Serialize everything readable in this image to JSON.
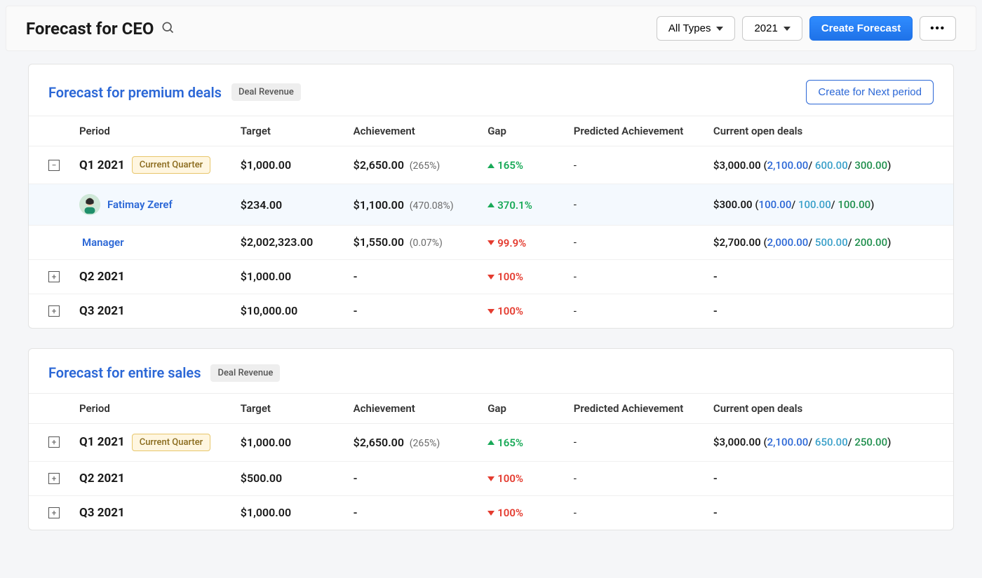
{
  "header": {
    "title": "Forecast for CEO",
    "type_filter": "All Types",
    "year_filter": "2021",
    "create_button": "Create Forecast"
  },
  "columns": {
    "period": "Period",
    "target": "Target",
    "achievement": "Achievement",
    "gap": "Gap",
    "predicted": "Predicted Achievement",
    "open_deals": "Current open deals"
  },
  "panels": [
    {
      "title": "Forecast for premium deals",
      "tag": "Deal Revenue",
      "action_button": "Create for Next period",
      "rows": [
        {
          "expand": "minus",
          "period": "Q1 2021",
          "current": "Current Quarter",
          "target": "$1,000.00",
          "achievement": "$2,650.00",
          "achievement_pct": "(265%)",
          "gap_dir": "up",
          "gap": "165%",
          "predicted": "-",
          "deals_total": "$3,000.00",
          "deals_b1": "2,100.00",
          "deals_b2": "600.00",
          "deals_b3": "300.00"
        },
        {
          "sub": true,
          "avatar": true,
          "name": "Fatimay Zeref",
          "target": "$234.00",
          "achievement": "$1,100.00",
          "achievement_pct": "(470.08%)",
          "gap_dir": "up",
          "gap": "370.1%",
          "predicted": "-",
          "deals_total": "$300.00",
          "deals_b1": "100.00",
          "deals_b2": "100.00",
          "deals_b3": "100.00"
        },
        {
          "sub": false,
          "name_only": true,
          "name": "Manager",
          "target": "$2,002,323.00",
          "achievement": "$1,550.00",
          "achievement_pct": "(0.07%)",
          "gap_dir": "down",
          "gap": "99.9%",
          "predicted": "-",
          "deals_total": "$2,700.00",
          "deals_b1": "2,000.00",
          "deals_b2": "500.00",
          "deals_b3": "200.00"
        },
        {
          "expand": "plus",
          "period": "Q2 2021",
          "target": "$1,000.00",
          "achievement": "-",
          "gap_dir": "down",
          "gap": "100%",
          "predicted": "-",
          "open_dash": "-"
        },
        {
          "expand": "plus",
          "period": "Q3 2021",
          "target": "$10,000.00",
          "achievement": "-",
          "gap_dir": "down",
          "gap": "100%",
          "predicted": "-",
          "open_dash": "-"
        }
      ]
    },
    {
      "title": "Forecast for entire sales",
      "tag": "Deal Revenue",
      "rows": [
        {
          "expand": "plus",
          "period": "Q1 2021",
          "current": "Current Quarter",
          "target": "$1,000.00",
          "achievement": "$2,650.00",
          "achievement_pct": "(265%)",
          "gap_dir": "up",
          "gap": "165%",
          "predicted": "-",
          "deals_total": "$3,000.00",
          "deals_b1": "2,100.00",
          "deals_b2": "650.00",
          "deals_b3": "250.00"
        },
        {
          "expand": "plus",
          "period": "Q2 2021",
          "target": "$500.00",
          "achievement": "-",
          "gap_dir": "down",
          "gap": "100%",
          "predicted": "-",
          "open_dash": "-"
        },
        {
          "expand": "plus",
          "period": "Q3 2021",
          "target": "$1,000.00",
          "achievement": "-",
          "gap_dir": "down",
          "gap": "100%",
          "predicted": "-",
          "open_dash": "-"
        }
      ]
    }
  ]
}
